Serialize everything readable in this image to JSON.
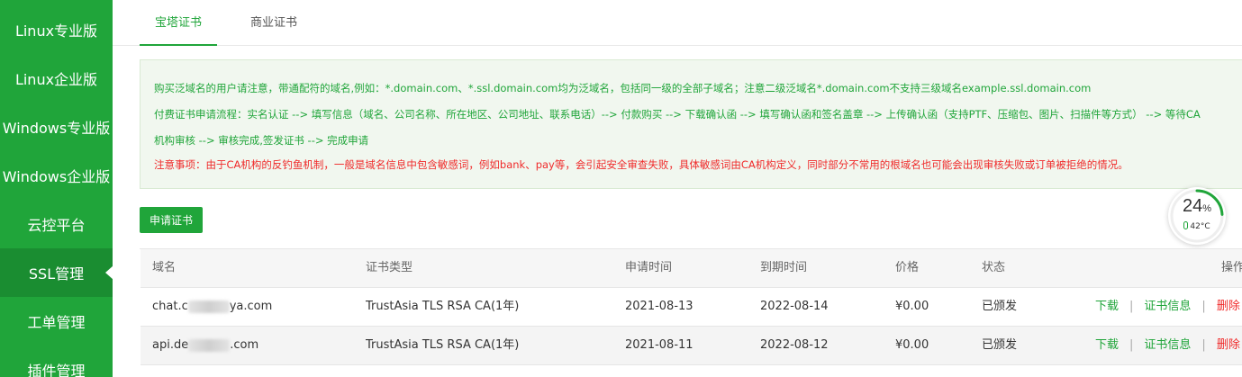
{
  "sidebar": {
    "items": [
      {
        "label": "Linux专业版"
      },
      {
        "label": "Linux企业版"
      },
      {
        "label": "Windows专业版"
      },
      {
        "label": "Windows企业版"
      },
      {
        "label": "云控平台"
      },
      {
        "label": "SSL管理"
      },
      {
        "label": "工单管理"
      },
      {
        "label": "插件管理"
      }
    ],
    "active": "SSL管理"
  },
  "tabs": [
    {
      "label": "宝塔证书",
      "active": true
    },
    {
      "label": "商业证书",
      "active": false
    }
  ],
  "notice": {
    "line1": "购买泛域名的用户请注意，带通配符的域名,例如：*.domain.com、*.ssl.domain.com均为泛域名，包括同一级的全部子域名；注意二级泛域名*.domain.com不支持三级域名example.ssl.domain.com",
    "line2": "付费证书申请流程：实名认证 --> 填写信息（域名、公司名称、所在地区、公司地址、联系电话）--> 付款购买 --> 下载确认函 --> 填写确认函和签名盖章 --> 上传确认函（支持PTF、压缩包、图片、扫描件等方式） --> 等待CA",
    "line3": "机构审核 --> 审核完成,签发证书 --> 完成申请",
    "warning": "注意事项：由于CA机构的反钓鱼机制，一般是域名信息中包含敏感词，例如bank、pay等，会引起安全审查失败，具体敏感词由CA机构定义，同时部分不常用的根域名也可能会出现审核失败或订单被拒绝的情况。"
  },
  "apply_button": "申请证书",
  "gauge": {
    "percent": "24",
    "unit": "%",
    "temp": "42°C"
  },
  "table": {
    "headers": {
      "domain": "域名",
      "type": "证书类型",
      "apply": "申请时间",
      "expire": "到期时间",
      "price": "价格",
      "status": "状态",
      "ops": "操作"
    },
    "rows": [
      {
        "domain_start": "chat.c",
        "domain_end": "ya.com",
        "type": "TrustAsia TLS RSA CA(1年)",
        "apply": "2021-08-13",
        "expire": "2022-08-14",
        "price": "¥0.00",
        "status": "已颁发"
      },
      {
        "domain_start": "api.de",
        "domain_end": ".com",
        "type": "TrustAsia TLS RSA CA(1年)",
        "apply": "2021-08-11",
        "expire": "2022-08-12",
        "price": "¥0.00",
        "status": "已颁发"
      }
    ],
    "actions": {
      "download": "下载",
      "info": "证书信息",
      "delete": "删除",
      "sep": "|"
    }
  },
  "colors": {
    "accent": "#20a53a",
    "danger": "#f02b2b"
  }
}
